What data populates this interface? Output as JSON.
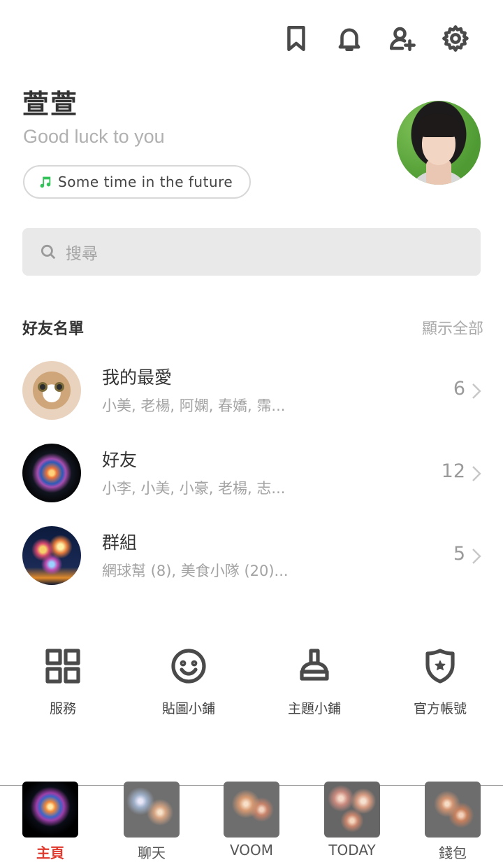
{
  "top_actions": [
    {
      "name": "bookmark-icon"
    },
    {
      "name": "bell-icon"
    },
    {
      "name": "add-friend-icon"
    },
    {
      "name": "gear-icon"
    }
  ],
  "profile": {
    "name": "萱萱",
    "status": "Good luck to you",
    "music": "Some time in the future"
  },
  "search": {
    "placeholder": "搜尋"
  },
  "friends_section": {
    "title": "好友名單",
    "show_all": "顯示全部",
    "rows": [
      {
        "name": "我的最愛",
        "members": "小美, 老楊, 阿嫻, 春嬌, 霈...",
        "count": "6"
      },
      {
        "name": "好友",
        "members": "小李, 小美, 小豪, 老楊, 志...",
        "count": "12"
      },
      {
        "name": "群組",
        "members": "網球幫 (8), 美食小隊 (20)...",
        "count": "5"
      }
    ]
  },
  "shortcuts": [
    {
      "label": "服務",
      "icon": "grid-icon"
    },
    {
      "label": "貼圖小鋪",
      "icon": "smiley-icon"
    },
    {
      "label": "主題小鋪",
      "icon": "brush-icon"
    },
    {
      "label": "官方帳號",
      "icon": "shield-star-icon"
    }
  ],
  "tabs": [
    {
      "label": "主頁",
      "active": true
    },
    {
      "label": "聊天",
      "active": false
    },
    {
      "label": "VOOM",
      "active": false
    },
    {
      "label": "TODAY",
      "active": false
    },
    {
      "label": "錢包",
      "active": false
    }
  ],
  "colors": {
    "accent_active_tab": "#e03a2f",
    "music_note": "#35c25a"
  }
}
